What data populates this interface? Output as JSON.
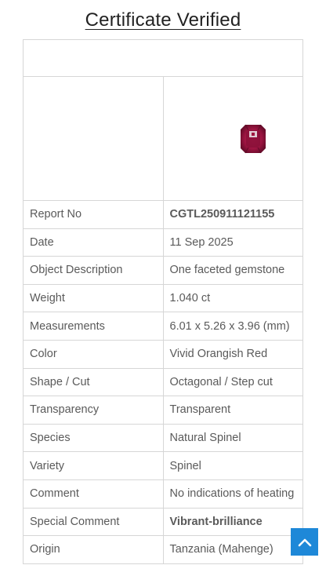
{
  "page": {
    "title": "Certificate Verified"
  },
  "image": {
    "icon": "gemstone-image"
  },
  "rows": [
    {
      "label": "Report No",
      "value": "CGTL250911121155",
      "bold": true
    },
    {
      "label": "Date",
      "value": "11 Sep 2025",
      "bold": false
    },
    {
      "label": "Object Description",
      "value": "One faceted gemstone",
      "bold": false
    },
    {
      "label": "Weight",
      "value": "1.040  ct",
      "bold": false
    },
    {
      "label": "Measurements",
      "value": "6.01 x 5.26 x 3.96 (mm)",
      "bold": false
    },
    {
      "label": "Color",
      "value": "Vivid Orangish Red",
      "bold": false
    },
    {
      "label": "Shape / Cut",
      "value": "Octagonal / Step cut",
      "bold": false
    },
    {
      "label": "Transparency",
      "value": "Transparent",
      "bold": false
    },
    {
      "label": "Species",
      "value": "Natural Spinel",
      "bold": false
    },
    {
      "label": "Variety",
      "value": "Spinel",
      "bold": false
    },
    {
      "label": "Comment",
      "value": "No indications of heating",
      "bold": false
    },
    {
      "label": "Special Comment",
      "value": "Vibrant-brilliance",
      "bold": true
    },
    {
      "label": "Origin",
      "value": "Tanzania (Mahenge)",
      "bold": false
    }
  ],
  "scroll_top": {
    "icon": "chevron-up-icon"
  },
  "colors": {
    "accent": "#1e88d8",
    "gem": "#a0173f",
    "border": "#d6d6d6"
  }
}
